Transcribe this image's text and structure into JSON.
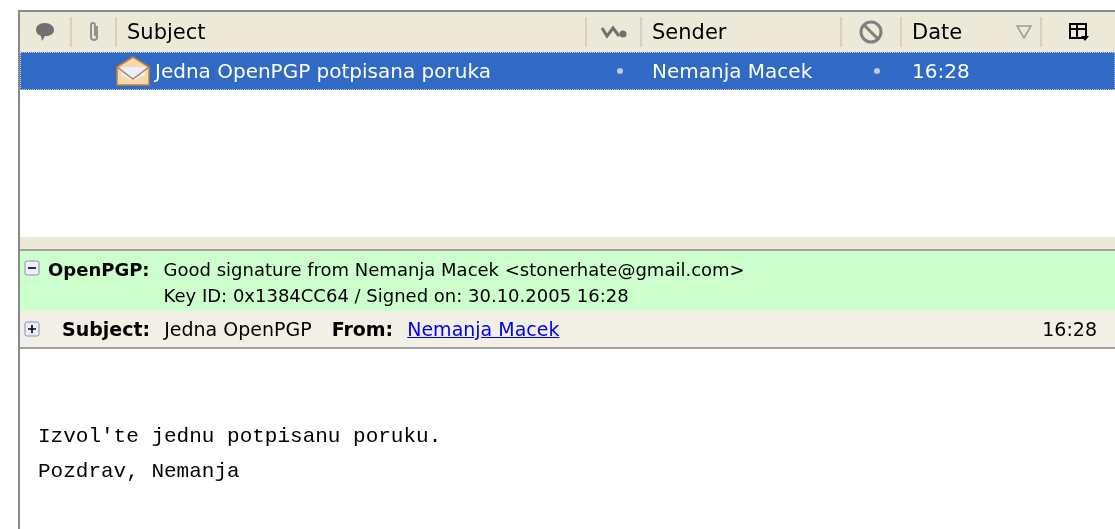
{
  "thread_pane": {
    "columns": [
      {
        "kind": "comment"
      },
      {
        "kind": "attachment"
      },
      {
        "kind": "text",
        "label": "Subject"
      },
      {
        "kind": "thread"
      },
      {
        "kind": "text",
        "label": "Sender"
      },
      {
        "kind": "junk"
      },
      {
        "kind": "text",
        "label": "Date",
        "sorted": true
      },
      {
        "kind": "picker"
      }
    ],
    "messages": [
      {
        "subject": "Jedna OpenPGP potpisana poruka",
        "sender": "Nemanja Macek",
        "date": "16:28",
        "selected": true
      }
    ]
  },
  "message_header": {
    "security": {
      "label": "OpenPGP:",
      "expanded": true,
      "lines": [
        "Good signature from Nemanja Macek <stonerhate@gmail.com>",
        "Key ID: 0x1384CC64 / Signed on: 30.10.2005 16:28"
      ]
    },
    "summary": {
      "expanded": false,
      "subject_label": "Subject:",
      "subject": "Jedna OpenPGP",
      "from_label": "From:",
      "from": "Nemanja Macek",
      "date": "16:28"
    }
  },
  "body": [
    "Izvol'te jednu potpisanu poruku.",
    "Pozdrav, Nemanja"
  ]
}
